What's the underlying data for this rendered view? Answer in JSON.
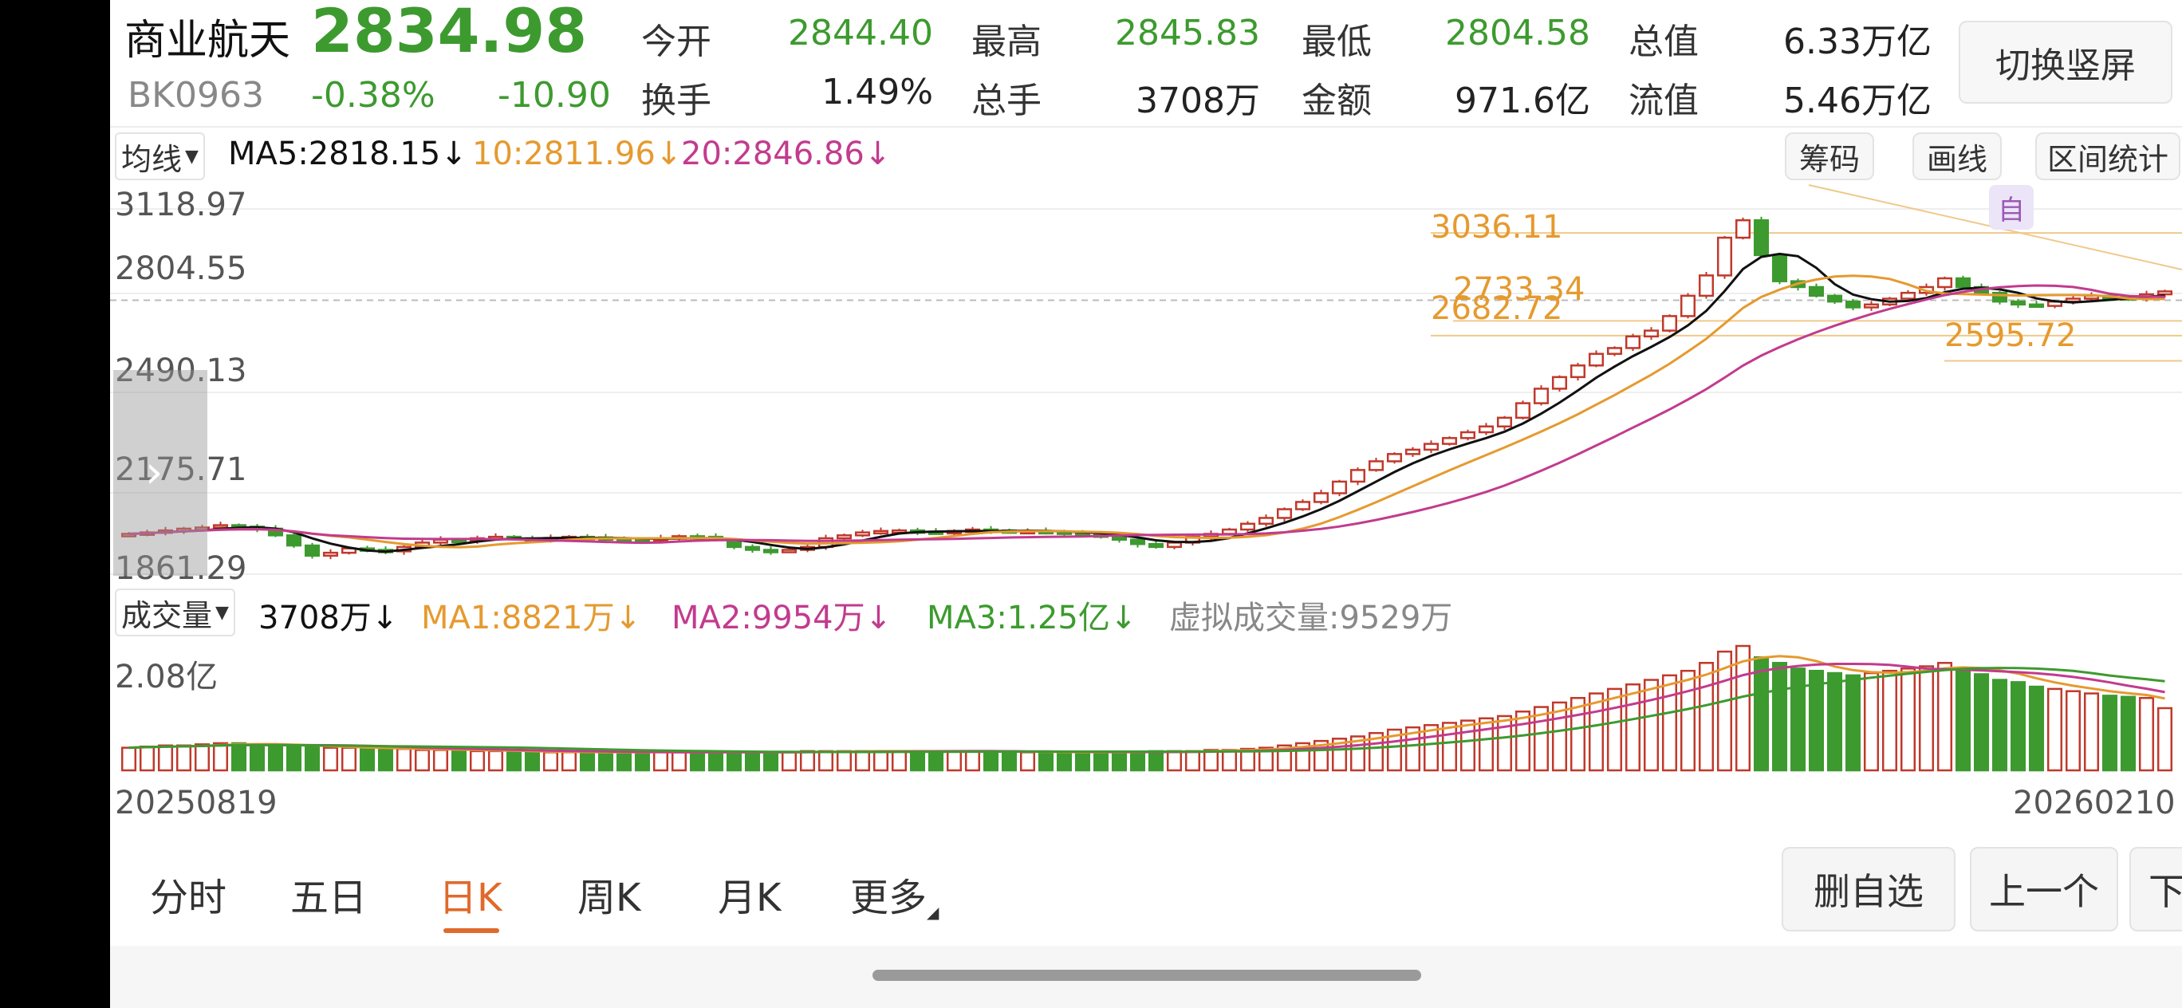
{
  "header": {
    "name": "商业航天",
    "code": "BK0963",
    "price": "2834.98",
    "change_pct": "-0.38%",
    "change_abs": "-10.90",
    "stats": [
      {
        "label": "今开",
        "value": "2844.40",
        "color": "#3d9a2f"
      },
      {
        "label": "最高",
        "value": "2845.83",
        "color": "#3d9a2f"
      },
      {
        "label": "最低",
        "value": "2804.58",
        "color": "#3d9a2f"
      },
      {
        "label": "总值",
        "value": "6.33万亿",
        "color": "#222222"
      },
      {
        "label": "换手",
        "value": "1.49%",
        "color": "#222222"
      },
      {
        "label": "总手",
        "value": "3708万",
        "color": "#222222"
      },
      {
        "label": "金额",
        "value": "971.6亿",
        "color": "#222222"
      },
      {
        "label": "流值",
        "value": "5.46万亿",
        "color": "#222222"
      }
    ],
    "switch_button": "切换竖屏"
  },
  "ma_bar": {
    "dropdown": "均线",
    "ma5": "MA5:2818.15↓",
    "ma10": "10:2811.96↓",
    "ma20": "20:2846.86↓",
    "tools": [
      "筹码",
      "画线",
      "区间统计"
    ]
  },
  "price_axis": [
    "3118.97",
    "2804.55",
    "2490.13",
    "2175.71",
    "1861.29"
  ],
  "annotations": {
    "high": "3036.11",
    "mid1": "2733.34",
    "mid2": "2682.72",
    "low": "2595.72",
    "self_tag": "自"
  },
  "volume_bar": {
    "dropdown": "成交量",
    "current": "3708万↓",
    "ma1": "MA1:8821万↓",
    "ma2": "MA2:9954万↓",
    "ma3": "MA3:1.25亿↓",
    "virtual": "虚拟成交量:9529万",
    "axis_max": "2.08亿"
  },
  "dates": {
    "start": "20250819",
    "end": "20260210"
  },
  "bottom_tabs": [
    "分时",
    "五日",
    "日K",
    "周K",
    "月K",
    "更多"
  ],
  "active_tab": "日K",
  "bottom_buttons": [
    "删自选",
    "上一个",
    "下一个"
  ],
  "colors": {
    "up": "#c0392b",
    "down": "#3d9a2f",
    "ma5": "#111111",
    "ma10": "#e59a2f",
    "ma20": "#c23b8e",
    "accent": "#e06a2b"
  },
  "chart_data": {
    "type": "candlestick",
    "ylim": [
      1861.29,
      3118.97
    ],
    "closes": [
      2000,
      2005,
      2012,
      2018,
      2022,
      2030,
      2025,
      2018,
      1995,
      1960,
      1925,
      1935,
      1950,
      1945,
      1940,
      1955,
      1970,
      1980,
      1978,
      1985,
      1990,
      1985,
      1982,
      1986,
      1990,
      1988,
      1985,
      1980,
      1978,
      1985,
      1992,
      1990,
      1980,
      1955,
      1945,
      1940,
      1945,
      1955,
      1985,
      1995,
      2005,
      2010,
      2012,
      2008,
      2004,
      2010,
      2015,
      2012,
      2008,
      2010,
      2008,
      2004,
      1998,
      1992,
      1980,
      1965,
      1955,
      1970,
      1990,
      2000,
      2015,
      2035,
      2055,
      2085,
      2110,
      2140,
      2180,
      2220,
      2250,
      2275,
      2290,
      2310,
      2330,
      2350,
      2370,
      2400,
      2450,
      2500,
      2540,
      2580,
      2620,
      2640,
      2680,
      2700,
      2750,
      2820,
      2890,
      3020,
      3080,
      2960,
      2870,
      2850,
      2820,
      2800,
      2780,
      2790,
      2810,
      2830,
      2850,
      2880,
      2850,
      2830,
      2800,
      2790,
      2785,
      2800,
      2810,
      2820,
      2815,
      2810,
      2825,
      2835
    ],
    "volume": [
      0.2,
      0.21,
      0.22,
      0.22,
      0.23,
      0.24,
      0.24,
      0.23,
      0.22,
      0.21,
      0.21,
      0.2,
      0.2,
      0.19,
      0.19,
      0.19,
      0.18,
      0.18,
      0.18,
      0.17,
      0.17,
      0.17,
      0.16,
      0.16,
      0.16,
      0.16,
      0.16,
      0.16,
      0.16,
      0.16,
      0.16,
      0.16,
      0.16,
      0.16,
      0.16,
      0.16,
      0.16,
      0.17,
      0.17,
      0.17,
      0.17,
      0.17,
      0.17,
      0.17,
      0.17,
      0.17,
      0.17,
      0.17,
      0.16,
      0.16,
      0.16,
      0.16,
      0.16,
      0.16,
      0.16,
      0.16,
      0.17,
      0.17,
      0.17,
      0.18,
      0.18,
      0.19,
      0.2,
      0.22,
      0.24,
      0.26,
      0.28,
      0.3,
      0.33,
      0.36,
      0.38,
      0.4,
      0.42,
      0.44,
      0.46,
      0.48,
      0.52,
      0.56,
      0.6,
      0.64,
      0.68,
      0.72,
      0.76,
      0.8,
      0.84,
      0.88,
      0.95,
      1.05,
      1.1,
      1.0,
      0.95,
      0.9,
      0.88,
      0.86,
      0.84,
      0.86,
      0.88,
      0.9,
      0.92,
      0.95,
      0.9,
      0.85,
      0.8,
      0.78,
      0.74,
      0.72,
      0.7,
      0.68,
      0.66,
      0.65,
      0.64,
      0.55
    ]
  }
}
